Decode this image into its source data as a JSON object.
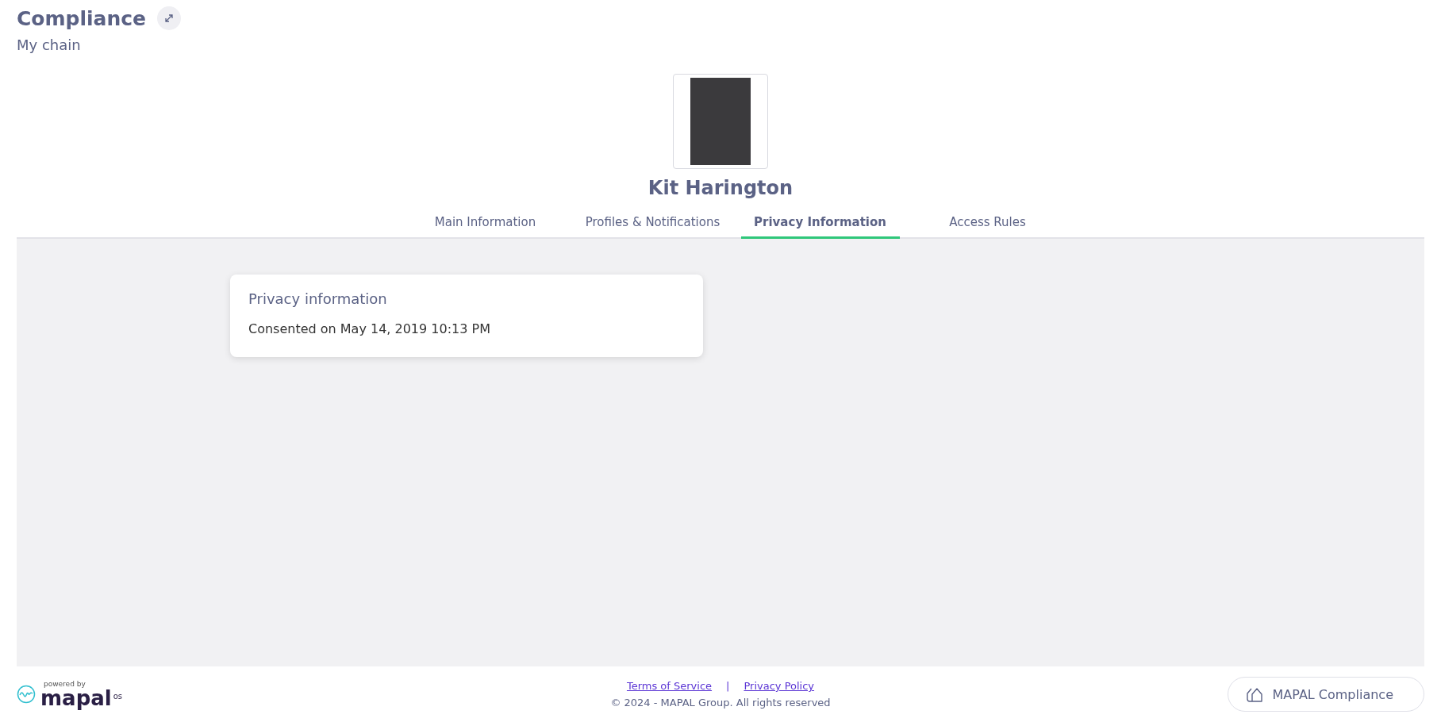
{
  "header": {
    "title": "Compliance",
    "subtitle": "My chain"
  },
  "profile": {
    "name": "Kit Harington"
  },
  "tabs": [
    {
      "label": "Main Information",
      "selected": false
    },
    {
      "label": "Profiles & Notifications",
      "selected": false
    },
    {
      "label": "Privacy Information",
      "selected": true
    },
    {
      "label": "Access Rules",
      "selected": false
    }
  ],
  "card": {
    "title": "Privacy information",
    "text": "Consented on May 14, 2019 10:13 PM"
  },
  "footer": {
    "logo": {
      "tagline": "powered by",
      "wordmark": "mapal",
      "suffix": "os"
    },
    "links": [
      "Terms of Service",
      "Privacy Policy"
    ],
    "separator": "|",
    "copyright": "© 2024 - MAPAL Group. All rights reserved",
    "app_button": "MAPAL Compliance"
  }
}
